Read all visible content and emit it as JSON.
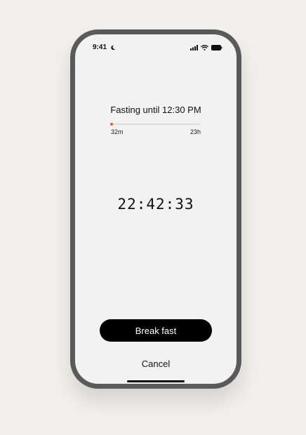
{
  "status_bar": {
    "time": "9:41",
    "icons": [
      "moon-icon",
      "signal-icon",
      "wifi-icon",
      "battery-icon"
    ]
  },
  "fasting": {
    "title": "Fasting until 12:30 PM",
    "elapsed_label": "32m",
    "total_label": "23h",
    "progress_fraction": 0.023
  },
  "timer": {
    "value": "22:42:33"
  },
  "actions": {
    "break_fast_label": "Break fast",
    "cancel_label": "Cancel"
  },
  "colors": {
    "accent": "#e05a3a",
    "button_bg": "#000000",
    "screen_bg": "#f2f2f2",
    "frame": "#5a5a5a",
    "page_bg": "#f3f0eb"
  }
}
